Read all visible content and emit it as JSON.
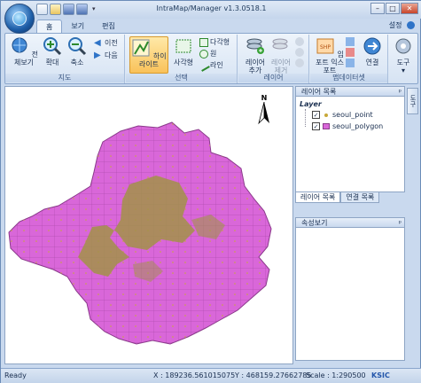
{
  "window": {
    "title": "IntraMap/Manager v1.3.0518.1",
    "min": "–",
    "max": "□",
    "close": "✕"
  },
  "tabs": [
    {
      "label": "홈"
    },
    {
      "label": "보기"
    },
    {
      "label": "편집"
    }
  ],
  "settings_label": "설정",
  "ribbon": {
    "map_group": {
      "label": "지도",
      "full_view": "전체보기",
      "zoom_in": "확대",
      "zoom_out": "축소",
      "prev": "이전",
      "next": "다음"
    },
    "select_group": {
      "label": "선택",
      "highlight": "하이라이트",
      "rectangle": "사각형",
      "polygon": "다각형",
      "circle": "원",
      "line": "라인"
    },
    "layer_group": {
      "label": "레이어",
      "add_layer": "레이어 추가",
      "remove_layer": "레이어 제거"
    },
    "mapdataset_group": {
      "label": "맵데이터셋",
      "import_export": "임포트 익스포트",
      "connect": "연결"
    },
    "tools_group": {
      "tools": "도구"
    }
  },
  "layer_panel": {
    "title": "레이어 목록",
    "pin": "ᵖ",
    "root": "Layer",
    "layers": [
      {
        "name": "seoul_point",
        "checked": true
      },
      {
        "name": "seoul_polygon",
        "checked": true
      }
    ],
    "tabs": [
      {
        "label": "레이어 목록"
      },
      {
        "label": "연결 목록"
      }
    ]
  },
  "property_panel": {
    "title": "속성보기",
    "pin": "ᵖ"
  },
  "side_tab": "도구",
  "north": "N",
  "status": {
    "ready": "Ready",
    "x": "X : 189236.561015075",
    "y": "Y : 468159.27662785",
    "scale": "Scale : 1:290500",
    "logo": "KSIC"
  },
  "colors": {
    "polygon_fill": "#d967d9",
    "center_fill": "#a29248",
    "point": "#c7a838"
  }
}
